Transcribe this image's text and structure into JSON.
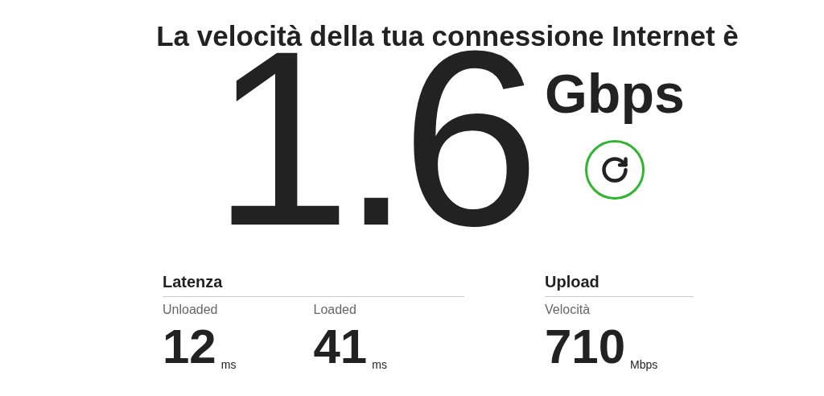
{
  "headline": "La velocità della tua connessione Internet è",
  "speed": {
    "value": "1.6",
    "unit": "Gbps"
  },
  "groups": [
    {
      "title": "Latenza",
      "metrics": [
        {
          "label": "Unloaded",
          "value": "12",
          "unit": "ms"
        },
        {
          "label": "Loaded",
          "value": "41",
          "unit": "ms"
        }
      ]
    },
    {
      "title": "Upload",
      "metrics": [
        {
          "label": "Velocità",
          "value": "710",
          "unit": "Mbps"
        }
      ]
    }
  ]
}
